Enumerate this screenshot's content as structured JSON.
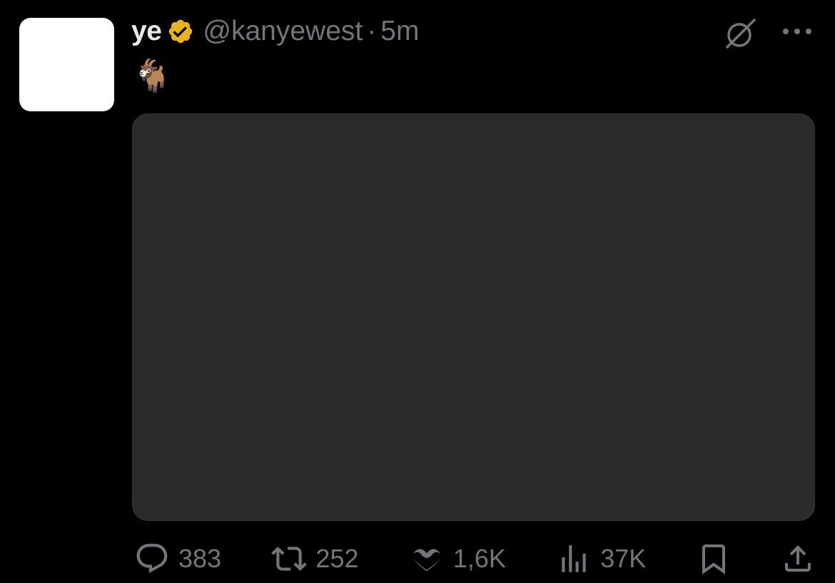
{
  "tweet": {
    "author": {
      "name": "ye",
      "handle": "@kanyewest",
      "verified": true,
      "verified_color": "#e8b321"
    },
    "separator": "·",
    "time": "5m",
    "text": "🐐",
    "media": {
      "description": "Attached photo (not reproduced)"
    }
  },
  "actions": {
    "reply_count": "383",
    "retweet_count": "252",
    "like_count": "1,6K",
    "view_count": "37K"
  },
  "icons": {
    "grok": "grok-icon",
    "more": "more-icon",
    "reply": "reply-icon",
    "retweet": "retweet-icon",
    "like": "heart-icon",
    "views": "analytics-icon",
    "bookmark": "bookmark-icon",
    "share": "share-icon"
  },
  "colors": {
    "background": "#000000",
    "primary_text": "#e7e9ea",
    "secondary_text": "#71767b"
  }
}
